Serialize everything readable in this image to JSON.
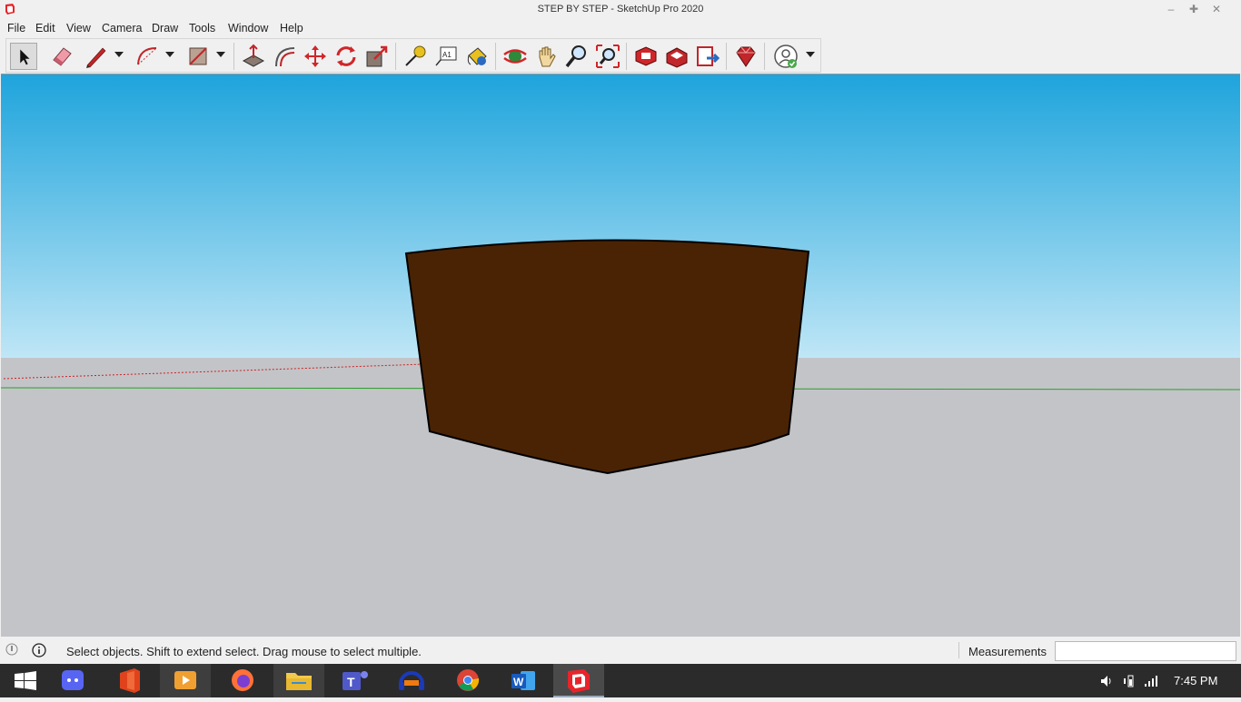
{
  "window": {
    "title": "STEP BY STEP - SketchUp Pro 2020",
    "icon": "sketchup-logo-icon"
  },
  "menu": [
    "File",
    "Edit",
    "View",
    "Camera",
    "Draw",
    "Tools",
    "Window",
    "Help"
  ],
  "toolbar": {
    "tools": [
      "select-tool-icon",
      "eraser-tool-icon",
      "pencil-line-tool-icon",
      "arc-tool-icon",
      "rectangle-tool-icon",
      "push-pull-tool-icon",
      "offset-tool-icon",
      "move-tool-icon",
      "rotate-tool-icon",
      "scale-tool-icon",
      "tape-measure-tool-icon",
      "text-tool-icon",
      "paint-bucket-tool-icon",
      "orbit-tool-icon",
      "pan-tool-icon",
      "zoom-tool-icon",
      "zoom-extents-tool-icon",
      "3d-warehouse-icon",
      "extension-warehouse-icon",
      "layout-send-icon",
      "extension-manager-icon",
      "account-icon"
    ]
  },
  "status": {
    "message": "Select objects. Shift to extend select. Drag mouse to select multiple.",
    "measurements_label": "Measurements",
    "measurements_value": ""
  },
  "taskbar": {
    "apps": [
      "windows-start-icon",
      "discord-icon",
      "office-icon",
      "media-player-icon",
      "firefox-icon",
      "file-explorer-icon",
      "teams-icon",
      "audacity-icon",
      "chrome-icon",
      "word-icon",
      "sketchup-icon"
    ],
    "time": "7:45 PM"
  },
  "colors": {
    "sky_top": "#1ea4dc",
    "sky_bottom": "#bfe6f6",
    "ground": "#c3c4c8",
    "shape_fill": "#4a2304",
    "green_axis": "#2aa02a",
    "red_axis": "#cc2222"
  }
}
